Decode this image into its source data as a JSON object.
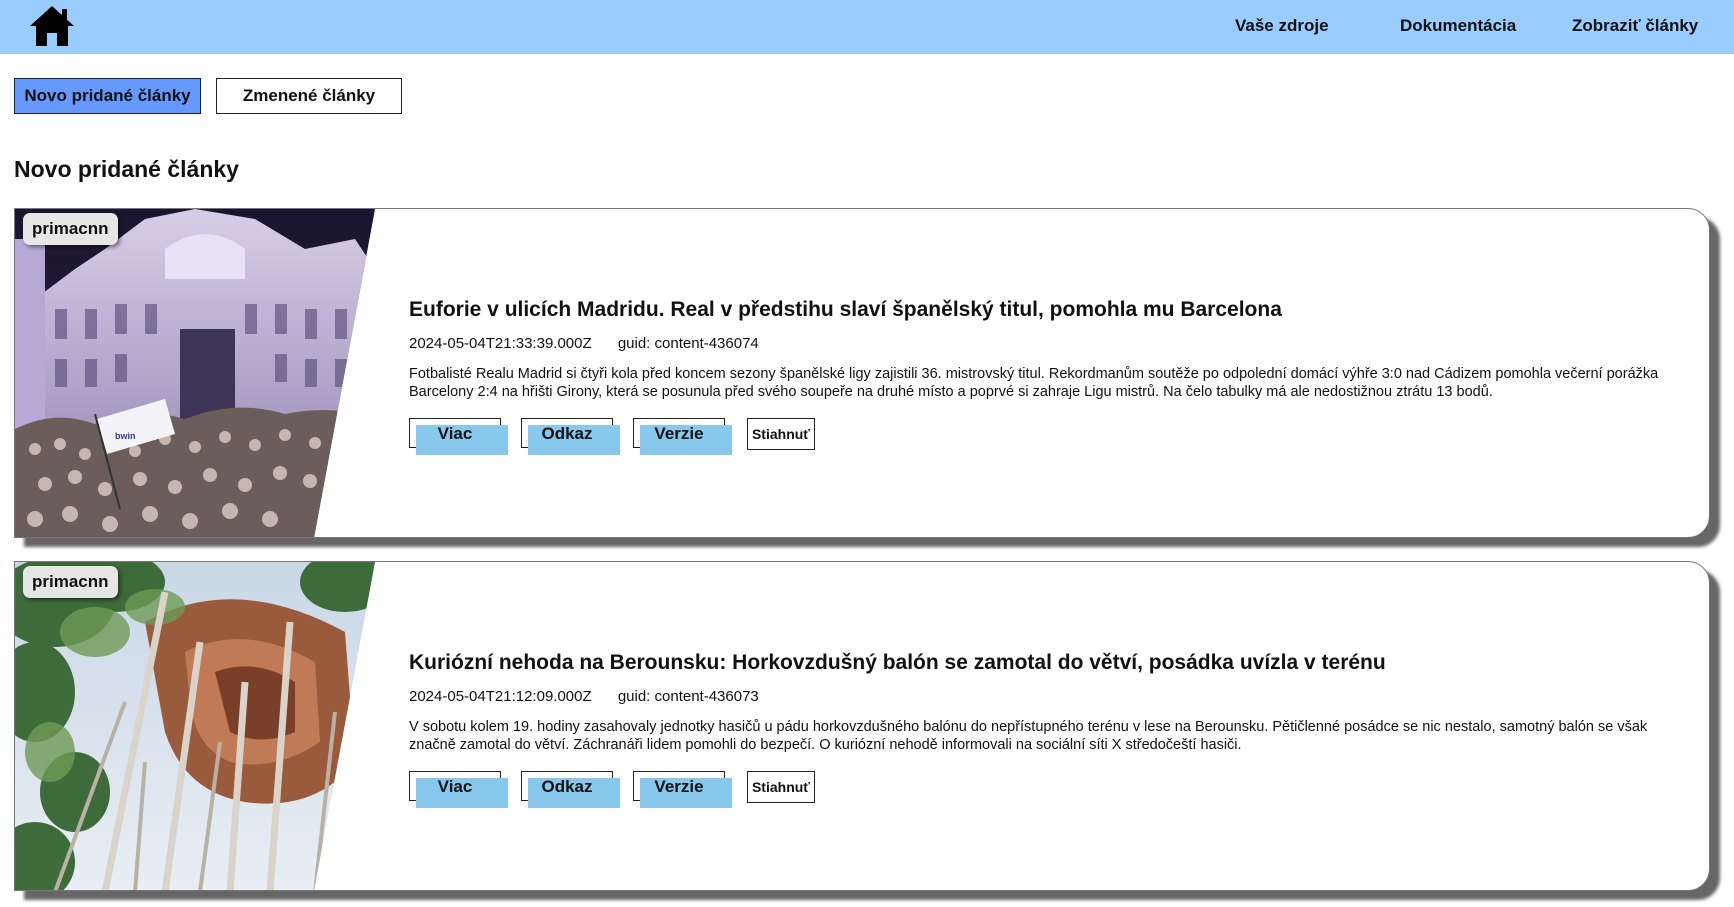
{
  "header": {
    "home_icon": "home-icon",
    "nav": [
      "Vaše zdroje",
      "Dokumentácia",
      "Zobraziť články"
    ]
  },
  "tabs": [
    "Novo pridané články",
    "Zmenené články"
  ],
  "active_tab": "Novo pridané články",
  "section_title": "Novo pridané články",
  "articles": [
    {
      "source": "primacnn",
      "title": "Euforie v ulicích Madridu. Real v předstihu slaví španělský titul, pomohla mu Barcelona",
      "date": "2024-05-04T21:33:39.000Z",
      "guid": "guid: content-436074",
      "description": "Fotbalisté Realu Madrid si čtyři kola před koncem sezony španělské ligy zajistili 36. mistrovský titul. Rekordmanům soutěže po odpolední domácí výhře 3:0 nad Cádizem pomohla večerní porážka Barcelony 2:4 na hřišti Girony, která se posunula před svého soupeře na druhé místo a poprvé si zahraje Ligu mistrů. Na čelo tabulky má ale nedostižnou ztrátu 13 bodů.",
      "image": "photo of crowd celebrating in front of illuminated building",
      "flag_text": "bwin"
    },
    {
      "source": "primacnn",
      "title": "Kuriózní nehoda na Berounsku: Horkovzdušný balón se zamotal do větví, posádka uvízla v terénu",
      "date": "2024-05-04T21:12:09.000Z",
      "guid": "guid: content-436073",
      "description": "V sobotu kolem 19. hodiny zasahovaly jednotky hasičů u pádu horkovzdušného balónu do nepřístupného terénu v lese na Berounsku. Pětičlenné posádce se nic nestalo, samotný balón se však značně zamotal do větví. Záchranáři lidem pomohli do bezpečí. O kuriózní nehodě informovali na sociální síti X středočeští hasiči.",
      "image": "photo of hot air balloon tangled in forest trees"
    }
  ],
  "actions": [
    "Viac",
    "Odkaz",
    "Verzie",
    "Stiahnuť"
  ],
  "colors": {
    "topbar": "#99ccff",
    "active_tab": "#6699ff",
    "action_button_fill": "#88c8ec"
  }
}
